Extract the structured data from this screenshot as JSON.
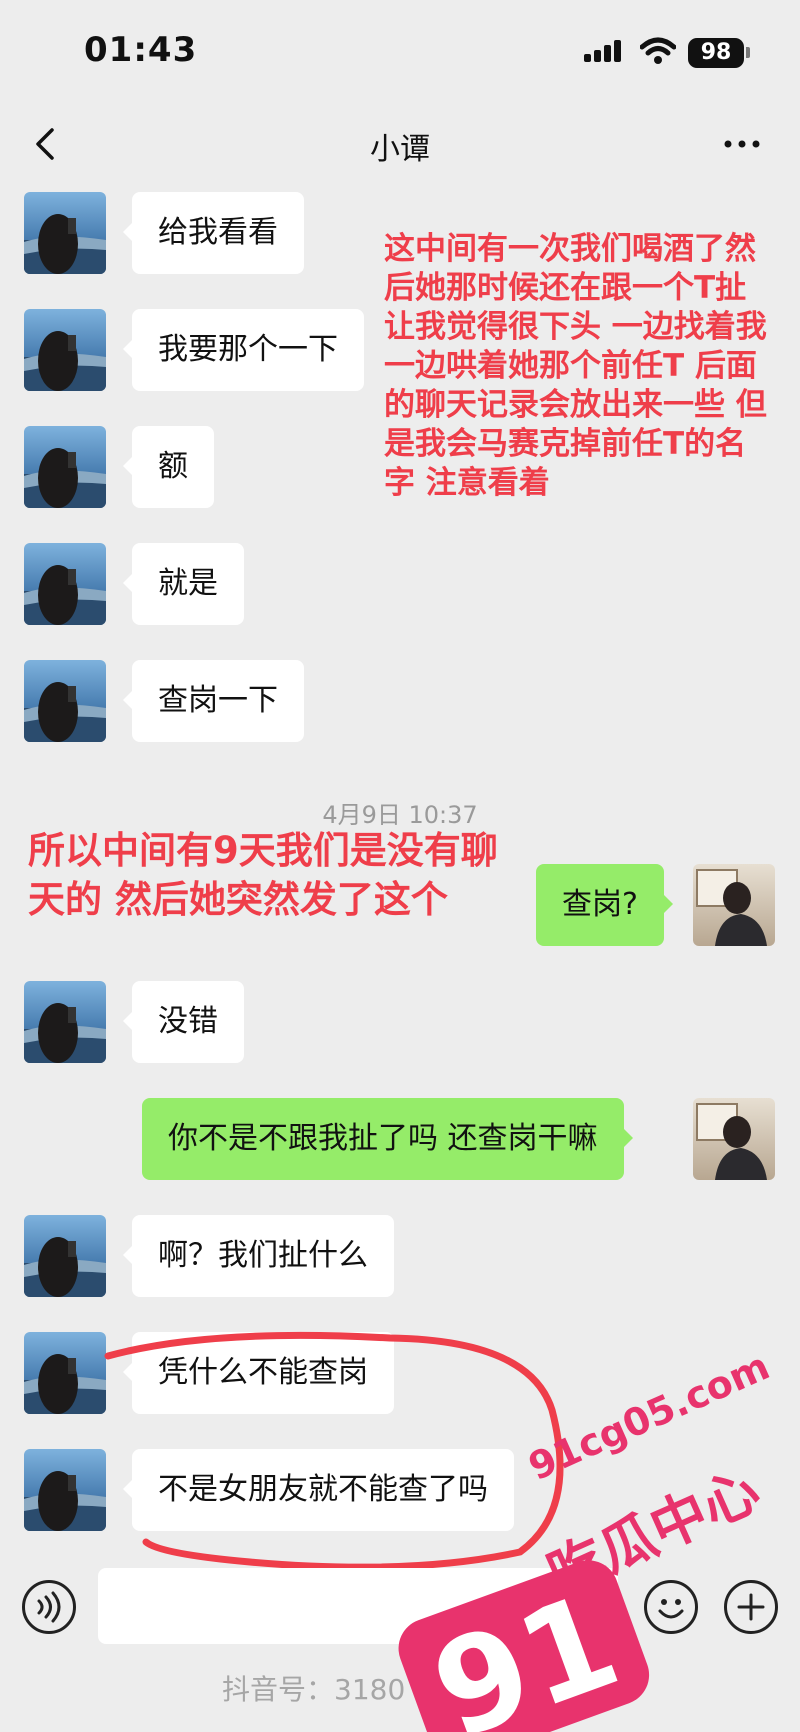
{
  "status_bar": {
    "time": "01:43",
    "battery": "98"
  },
  "nav": {
    "title": "小谭"
  },
  "messages": [
    {
      "side": "in",
      "text": "给我看看"
    },
    {
      "side": "in",
      "text": "我要那个一下"
    },
    {
      "side": "in",
      "text": "额"
    },
    {
      "side": "in",
      "text": "就是"
    },
    {
      "side": "in",
      "text": "查岗一下"
    },
    {
      "side": "out",
      "text": "查岗?"
    },
    {
      "side": "in",
      "text": "没错"
    },
    {
      "side": "out",
      "text": "你不是不跟我扯了吗 还查岗干嘛"
    },
    {
      "side": "in",
      "text": "啊？我们扯什么"
    },
    {
      "side": "in",
      "text": "凭什么不能查岗"
    },
    {
      "side": "in",
      "text": "不是女朋友就不能查了吗"
    }
  ],
  "timestamp": "4月9日 10:37",
  "annotations": {
    "note_top": "这中间有一次我们喝酒了然后她那时候还在跟一个T扯 让我觉得很下头 一边找着我一边哄着她那个前任T 后面的聊天记录会放出来一些 但是我会马赛克掉前任T的名字 注意看着",
    "note_mid": "所以中间有9天我们是没有聊天的 然后她突然发了这个",
    "highlight_color": "#ef3e4a"
  },
  "watermarks": {
    "douyin": "抖音号：3180 85787",
    "site": "91cg05.com",
    "site_name": "吃瓜中心",
    "logo_number": "91",
    "brand_color": "#e8336d"
  },
  "colors": {
    "incoming_bubble": "#ffffff",
    "outgoing_bubble": "#95ec69",
    "background": "#ededed"
  },
  "icons": [
    "back-icon",
    "more-icon",
    "voice-icon",
    "emoji-icon",
    "plus-icon"
  ]
}
